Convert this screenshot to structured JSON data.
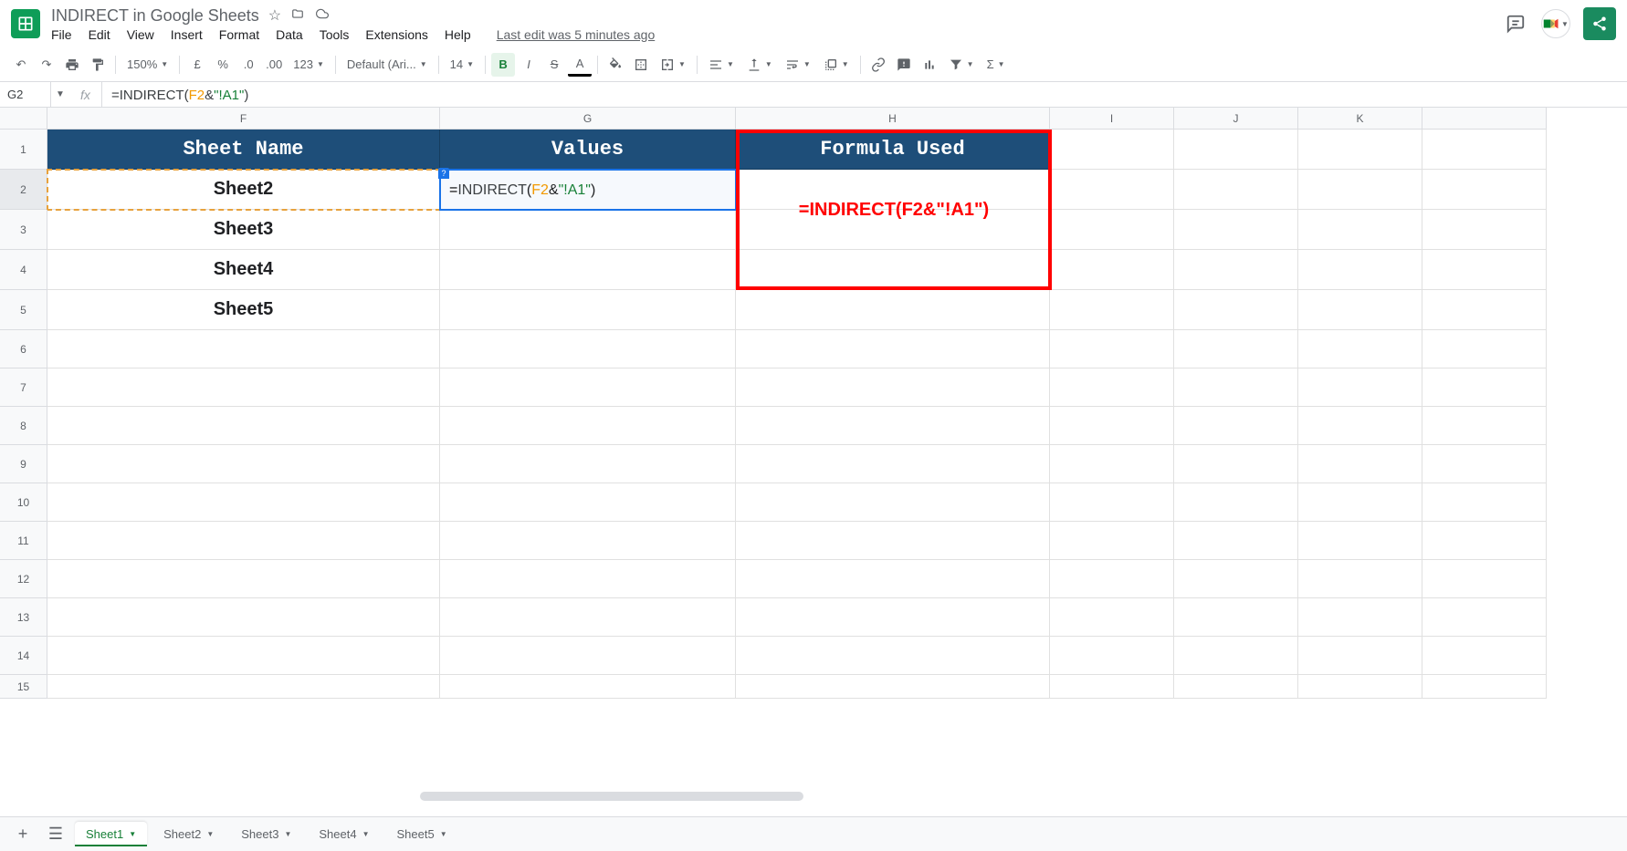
{
  "doc_title": "INDIRECT in Google Sheets",
  "menus": [
    "File",
    "Edit",
    "View",
    "Insert",
    "Format",
    "Data",
    "Tools",
    "Extensions",
    "Help"
  ],
  "last_edit": "Last edit was 5 minutes ago",
  "toolbar": {
    "zoom": "150%",
    "font": "Default (Ari...",
    "font_size": "14",
    "number_fmt": "123"
  },
  "formula_bar": {
    "cell_ref": "G2",
    "fx": "fx",
    "raw": "=INDIRECT(F2&\"!A1\")",
    "tokens": [
      {
        "t": "=",
        "c": "eq"
      },
      {
        "t": "INDIRECT",
        "c": "fn"
      },
      {
        "t": "(",
        "c": "op"
      },
      {
        "t": "F2",
        "c": "ref"
      },
      {
        "t": "&",
        "c": "op"
      },
      {
        "t": "\"!A1\"",
        "c": "str"
      },
      {
        "t": ")",
        "c": "op"
      }
    ]
  },
  "columns": [
    "F",
    "G",
    "H",
    "I",
    "J",
    "K"
  ],
  "rows": [
    "1",
    "2",
    "3",
    "4",
    "5",
    "6",
    "7",
    "8",
    "9",
    "10",
    "11",
    "12",
    "13",
    "14",
    "15"
  ],
  "headers": {
    "f1": "Sheet Name",
    "g1": "Values",
    "h1": "Formula Used"
  },
  "data": {
    "f2": "Sheet2",
    "f3": "Sheet3",
    "f4": "Sheet4",
    "f5": "Sheet5"
  },
  "active_cell_formula_tokens": [
    {
      "t": "=",
      "c": "eq"
    },
    {
      "t": "INDIRECT",
      "c": "fn"
    },
    {
      "t": "(",
      "c": "op"
    },
    {
      "t": "F2",
      "c": "ref"
    },
    {
      "t": "&",
      "c": "op"
    },
    {
      "t": "\"!A1\"",
      "c": "str"
    },
    {
      "t": ")",
      "c": "op"
    }
  ],
  "annotation": "=INDIRECT(F2&\"!A1\")",
  "sheets": [
    "Sheet1",
    "Sheet2",
    "Sheet3",
    "Sheet4",
    "Sheet5"
  ],
  "active_sheet": "Sheet1"
}
